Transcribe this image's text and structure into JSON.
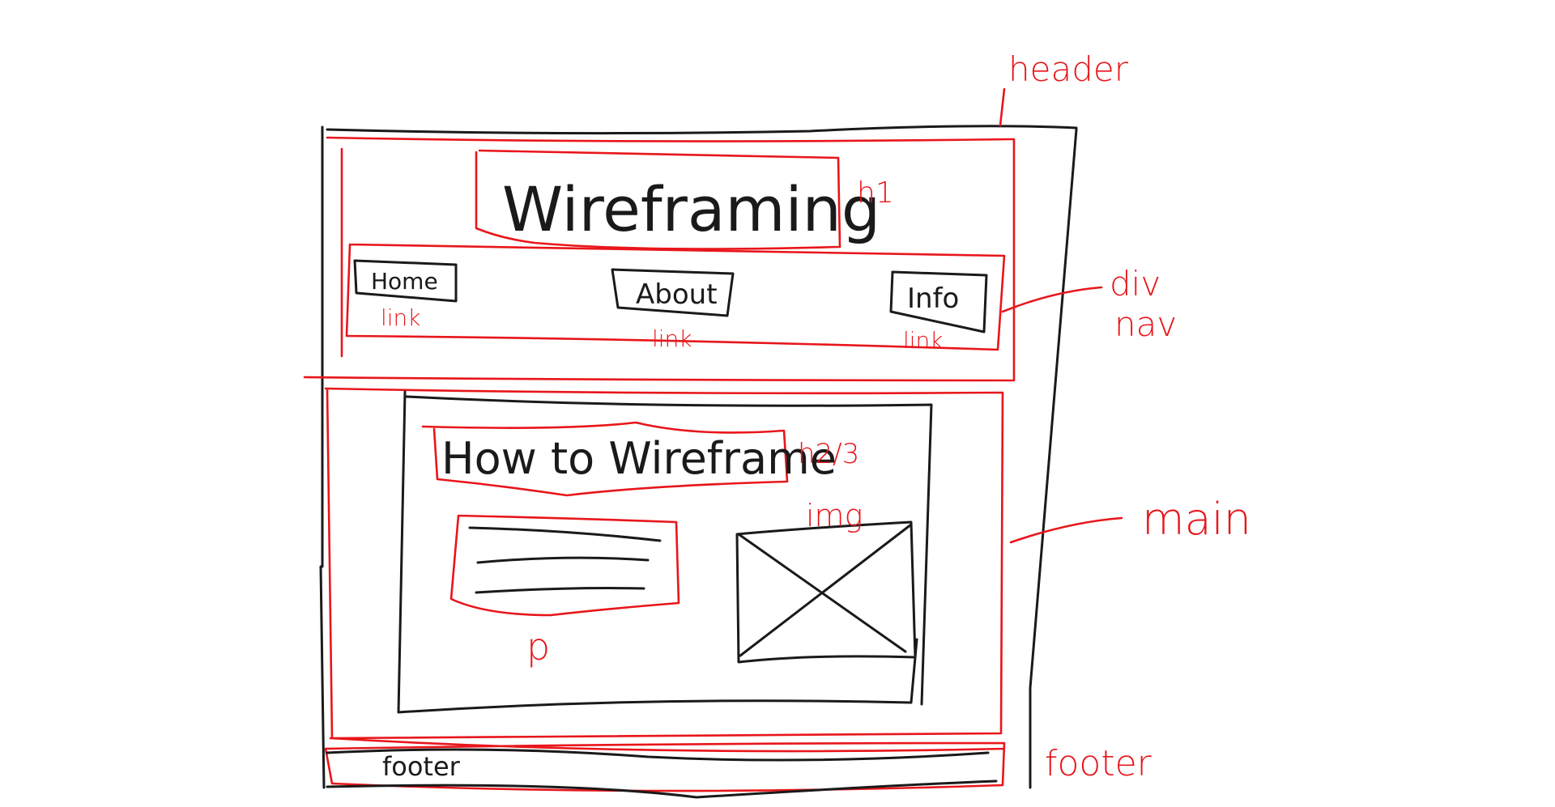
{
  "wireframe": {
    "title": "Wireframing",
    "nav_links": [
      "Home",
      "About",
      "Info"
    ],
    "article_heading": "How to Wireframe",
    "footer_text": "footer"
  },
  "annotations": {
    "header": "header",
    "h1": "h1",
    "div": "div",
    "nav": "nav",
    "link": "link",
    "h2_3": "h2/3",
    "img": "img",
    "p": "p",
    "main": "main",
    "footer": "footer"
  },
  "colors": {
    "ink": "#1a1a1a",
    "annotation": "#e8161b"
  }
}
